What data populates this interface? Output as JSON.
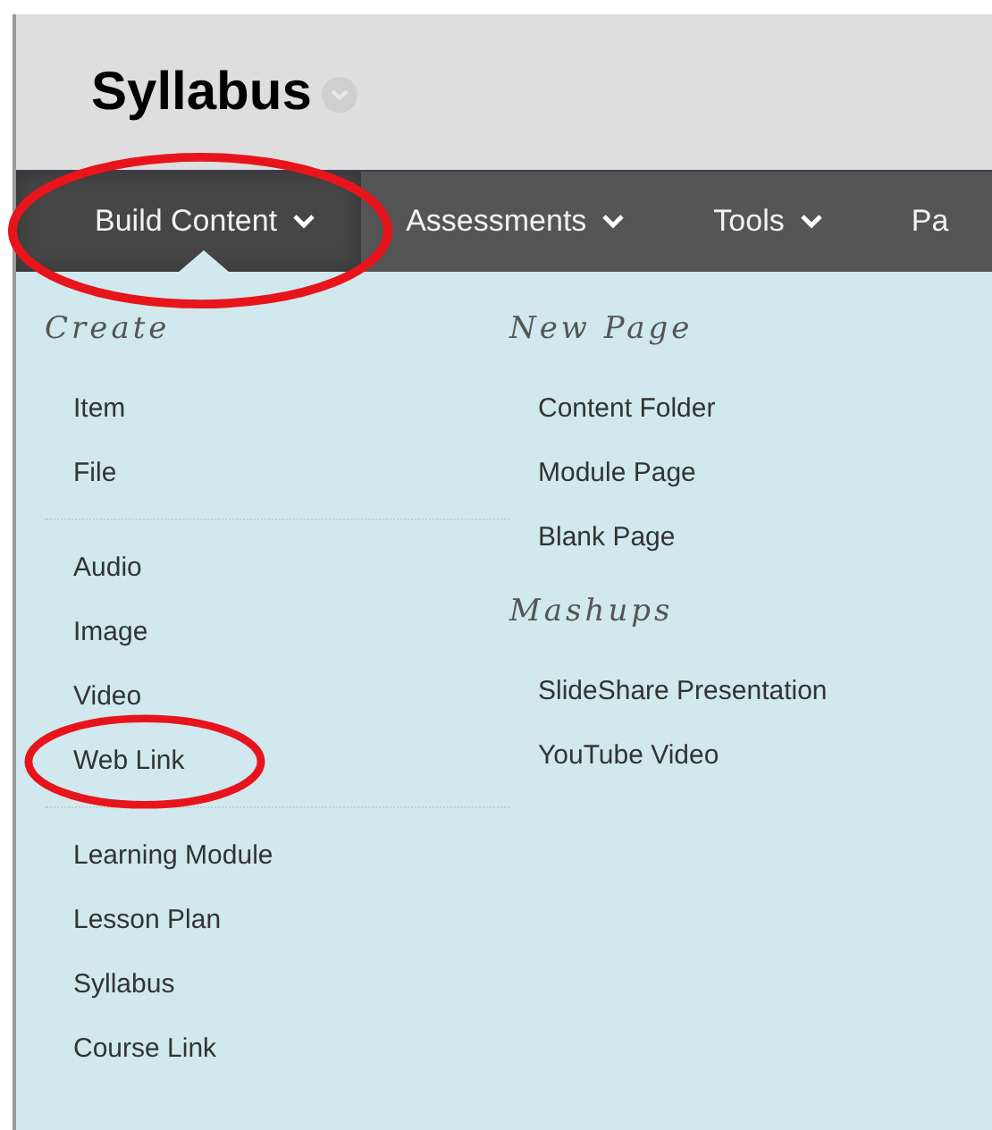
{
  "page": {
    "title": "Syllabus"
  },
  "nav": [
    {
      "label": "Build Content",
      "selected": true,
      "circled": true
    },
    {
      "label": "Assessments",
      "selected": false,
      "circled": false
    },
    {
      "label": "Tools",
      "selected": false,
      "circled": false
    },
    {
      "label": "Pa",
      "selected": false,
      "circled": false
    }
  ],
  "menu_columns": [
    {
      "sections": [
        {
          "heading": "Create",
          "groups": [
            [
              {
                "label": "Item",
                "circled": false
              },
              {
                "label": "File",
                "circled": false
              }
            ],
            [
              {
                "label": "Audio",
                "circled": false
              },
              {
                "label": "Image",
                "circled": false
              },
              {
                "label": "Video",
                "circled": false
              },
              {
                "label": "Web Link",
                "circled": true
              }
            ],
            [
              {
                "label": "Learning Module",
                "circled": false
              },
              {
                "label": "Lesson Plan",
                "circled": false
              },
              {
                "label": "Syllabus",
                "circled": false
              },
              {
                "label": "Course Link",
                "circled": false
              }
            ]
          ]
        }
      ]
    },
    {
      "sections": [
        {
          "heading": "New Page",
          "groups": [
            [
              {
                "label": "Content Folder",
                "circled": false
              },
              {
                "label": "Module Page",
                "circled": false
              },
              {
                "label": "Blank Page",
                "circled": false
              }
            ]
          ]
        },
        {
          "heading": "Mashups",
          "groups": [
            [
              {
                "label": "SlideShare Presentation",
                "circled": false
              },
              {
                "label": "YouTube Video",
                "circled": false
              }
            ]
          ]
        }
      ]
    }
  ]
}
